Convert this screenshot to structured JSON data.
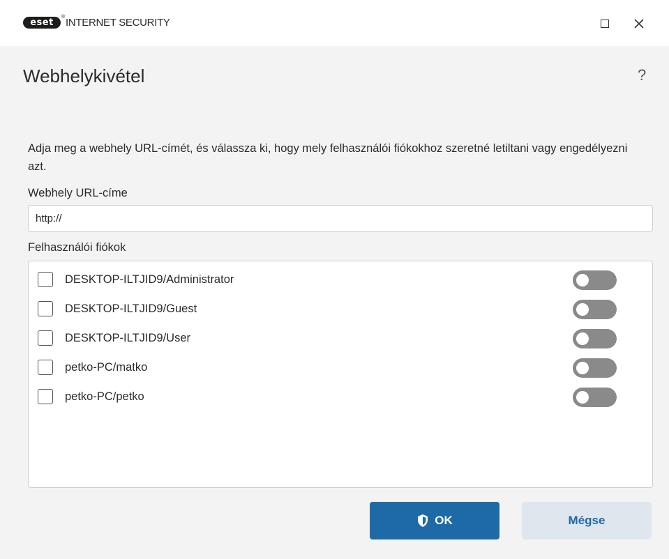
{
  "titlebar": {
    "brand_logo": "eset",
    "product_name": "INTERNET SECURITY",
    "buttons": [
      "maximize-icon",
      "close-icon"
    ]
  },
  "header": {
    "title": "Webhelykivétel",
    "help_label": "?"
  },
  "form": {
    "description": "Adja meg a webhely URL-címét, és válassza ki, hogy mely felhasználói fiókokhoz szeretné letiltani vagy engedélyezni azt.",
    "url_label": "Webhely URL-címe",
    "url_value": "http://",
    "accounts_label": "Felhasználói fiókok",
    "accounts": [
      {
        "name": "DESKTOP-ILTJID9/Administrator",
        "checked": false,
        "toggle_on": false
      },
      {
        "name": "DESKTOP-ILTJID9/Guest",
        "checked": false,
        "toggle_on": false
      },
      {
        "name": "DESKTOP-ILTJID9/User",
        "checked": false,
        "toggle_on": false
      },
      {
        "name": "petko-PC/matko",
        "checked": false,
        "toggle_on": false
      },
      {
        "name": "petko-PC/petko",
        "checked": false,
        "toggle_on": false
      }
    ]
  },
  "buttons": {
    "ok_label": "OK",
    "ok_icon": "shield-icon",
    "cancel_label": "Mégse"
  },
  "colors": {
    "accent": "#1d6aa7",
    "toggle_off": "#8a8a8a",
    "background": "#f3f3f3"
  }
}
